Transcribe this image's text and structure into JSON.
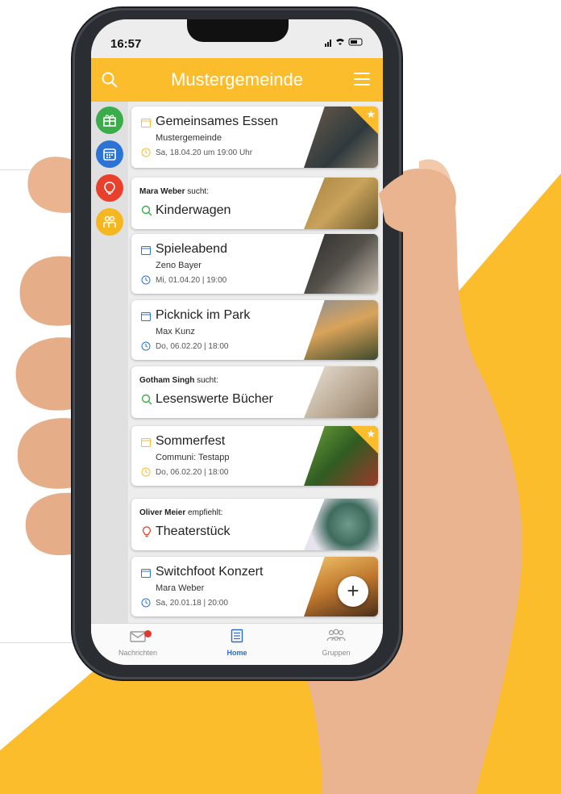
{
  "status": {
    "time": "16:57"
  },
  "appbar": {
    "title": "Mustergemeinde"
  },
  "colors": {
    "accent": "#fbbd2c",
    "cat_gift": "#3aad4a",
    "cat_calendar": "#2b74d6",
    "cat_idea": "#e8402d",
    "cat_group": "#f5b71f"
  },
  "categories": [
    "gift-icon",
    "calendar-icon",
    "lightbulb-icon",
    "people-icon"
  ],
  "cards": {
    "c1": {
      "title": "Gemeinsames Essen",
      "host": "Mustergemeinde",
      "date": "Sa, 18.04.20 um 19:00 Uhr"
    },
    "c2": {
      "user": "Mara Weber",
      "verb": "sucht:",
      "title": "Kinderwagen"
    },
    "c3": {
      "title": "Spieleabend",
      "host": "Zeno Bayer",
      "date": "Mi, 01.04.20 | 19:00"
    },
    "c4": {
      "title": "Picknick im Park",
      "host": "Max Kunz",
      "date": "Do, 06.02.20 | 18:00"
    },
    "c5": {
      "user": "Gotham Singh",
      "verb": "sucht:",
      "title": "Lesenswerte Bücher"
    },
    "c6": {
      "title": "Sommerfest",
      "host": "Communi: Testapp",
      "date": "Do, 06.02.20 | 18:00"
    },
    "c7": {
      "user": "Oliver Meier",
      "verb": "empfiehlt:",
      "title": "Theaterstück"
    },
    "c8": {
      "title": "Switchfoot Konzert",
      "host": "Mara Weber",
      "date": "Sa, 20.01.18 | 20:00"
    }
  },
  "fab": {
    "label": "+"
  },
  "tabs": {
    "messages": "Nachrichten",
    "home": "Home",
    "groups": "Gruppen"
  }
}
